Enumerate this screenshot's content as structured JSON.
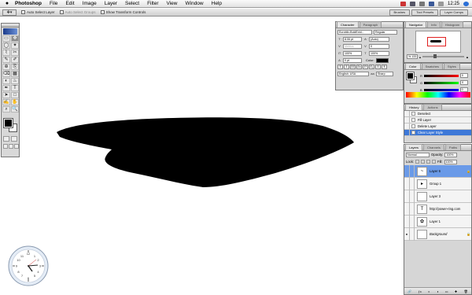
{
  "menubar": {
    "apple": "",
    "app_name": "Photoshop",
    "menus": [
      "File",
      "Edit",
      "Image",
      "Layer",
      "Select",
      "Filter",
      "View",
      "Window",
      "Help"
    ],
    "time": "12:25"
  },
  "optionsbar": {
    "auto_select_layer": "Auto Select Layer",
    "auto_select_groups": "Auto Select Groups",
    "show_transform_controls": "Show Transform Controls",
    "wells": [
      "Brushes",
      "Tool Presets",
      "Layer Comps"
    ]
  },
  "toolbox": {
    "tools": [
      "▭",
      "✥",
      "◯",
      "✦",
      "⌇",
      "✂",
      "✎",
      "✐",
      "⊕",
      "⎘",
      "⌫",
      "▦",
      "◐",
      "♨",
      "✒",
      "T",
      "➤",
      "□",
      "✍",
      "✋",
      "⌕",
      "🔍"
    ]
  },
  "character": {
    "tabs": [
      "Character",
      "Paragraph"
    ],
    "font_family": "Euroblix-BoldExtd...",
    "font_style": "Regular",
    "size": "8.06 pt",
    "leading": "(Auto)",
    "kerning": "Metrics",
    "tracking": "0",
    "vscale": "100%",
    "hscale": "100%",
    "baseline": "0 pt",
    "color_label": "Color:",
    "style_buttons": [
      "T",
      "T",
      "TT",
      "Tr",
      "T¹",
      "T₁",
      "T",
      "Ŧ"
    ],
    "language": "English: USA",
    "anti_alias_label": "aa",
    "anti_alias": "Sharp"
  },
  "navigator": {
    "tabs": [
      "Navigator",
      "Info",
      "Histogram"
    ],
    "zoom": "% 133"
  },
  "color": {
    "tabs": [
      "Color",
      "Swatches",
      "Styles"
    ],
    "channels": [
      {
        "label": "R",
        "value": "0"
      },
      {
        "label": "G",
        "value": "0"
      },
      {
        "label": "B",
        "value": "0"
      }
    ]
  },
  "history": {
    "tabs": [
      "History",
      "Actions"
    ],
    "items": [
      "Deselect",
      "Fill Layer",
      "Delete Layer",
      "Clear Layer Style"
    ],
    "selected_index": 3
  },
  "layers": {
    "tabs": [
      "Layers",
      "Channels",
      "Paths"
    ],
    "blend_mode": "Normal",
    "opacity_label": "Opacity:",
    "opacity": "100%",
    "lock_label": "Lock:",
    "fill_label": "Fill:",
    "fill": "100%",
    "items": [
      {
        "name": "Layer 6",
        "thumb": "~",
        "selected": true,
        "eye": "",
        "locked": true
      },
      {
        "name": "Group 1",
        "thumb": "▸",
        "selected": false,
        "eye": "",
        "locked": false
      },
      {
        "name": "Layer 3",
        "thumb": "",
        "selected": false,
        "eye": "",
        "locked": false
      },
      {
        "name": "http://power-ring.com",
        "thumb": "T",
        "selected": false,
        "eye": "",
        "locked": false
      },
      {
        "name": "Layer 1",
        "thumb": "✿",
        "selected": false,
        "eye": "",
        "locked": false
      },
      {
        "name": "Background",
        "thumb": "",
        "selected": false,
        "eye": "●",
        "locked": true
      }
    ],
    "footer_icons": [
      "🔗",
      "ƒx",
      "◐",
      "◑",
      "▭",
      "✚",
      "🗑"
    ]
  },
  "colors": {
    "accent": "#3d78d8",
    "selected_layer": "#6a9ae8",
    "shape": "#000000"
  }
}
